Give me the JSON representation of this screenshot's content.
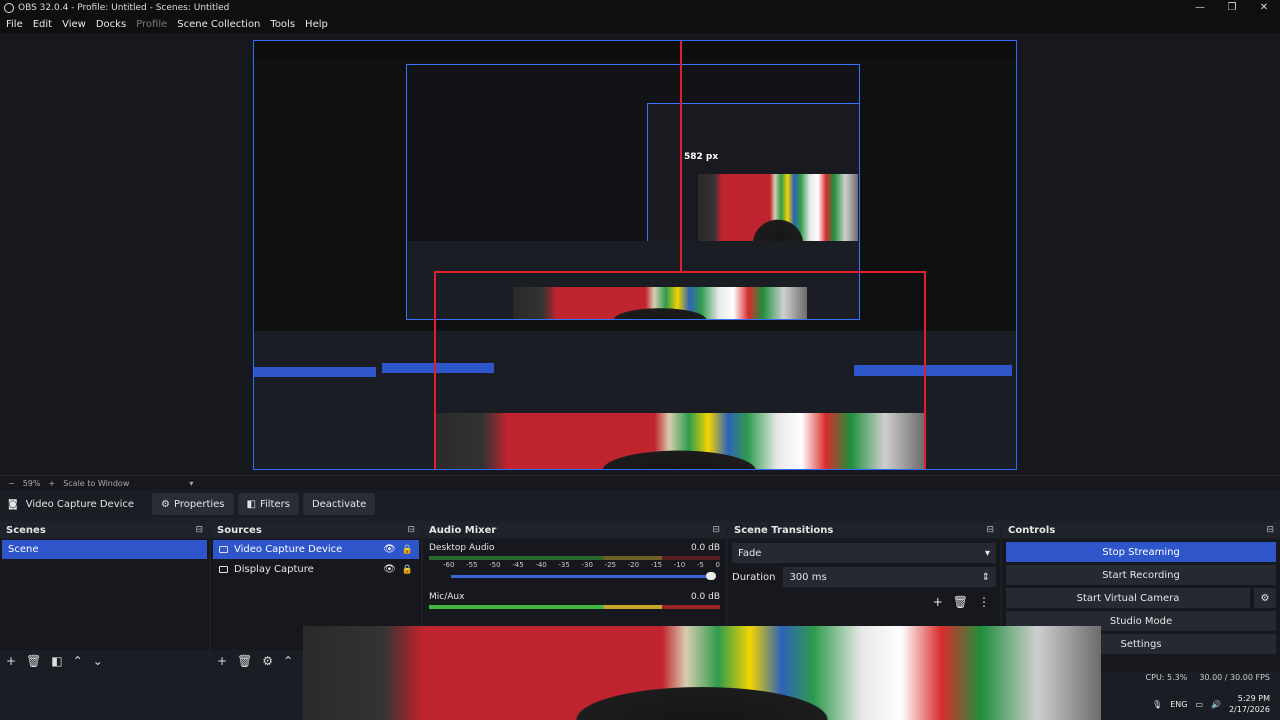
{
  "window": {
    "title": "OBS 32.0.4 - Profile: Untitled - Scenes: Untitled",
    "minimize": "—",
    "restore": "❐",
    "close": "✕"
  },
  "menu": {
    "file": "File",
    "edit": "Edit",
    "view": "View",
    "docks": "Docks",
    "profile": "Profile",
    "scene_collection": "Scene Collection",
    "tools": "Tools",
    "help": "Help"
  },
  "preview": {
    "measurement_label": "582 px"
  },
  "zoom": {
    "minus": "−",
    "value": "59%",
    "plus": "+",
    "mode": "Scale to Window",
    "dropdown": "▾"
  },
  "source_bar": {
    "source_name": "Video Capture Device",
    "properties": "Properties",
    "filters": "Filters",
    "deactivate": "Deactivate"
  },
  "scenes": {
    "title": "Scenes",
    "items": [
      "Scene"
    ]
  },
  "sources": {
    "title": "Sources",
    "items": [
      "Video Capture Device",
      "Display Capture"
    ]
  },
  "audio_mixer": {
    "title": "Audio Mixer",
    "tracks": [
      {
        "name": "Desktop Audio",
        "level": "0.0 dB"
      },
      {
        "name": "Mic/Aux",
        "level": "0.0 dB"
      }
    ],
    "ticks": [
      "-60",
      "-55",
      "-50",
      "-45",
      "-40",
      "-35",
      "-30",
      "-25",
      "-20",
      "-15",
      "-10",
      "-5",
      "0"
    ]
  },
  "scene_transitions": {
    "title": "Scene Transitions",
    "transition": "Fade",
    "duration_label": "Duration",
    "duration_value": "300 ms"
  },
  "controls": {
    "title": "Controls",
    "stop_streaming": "Stop Streaming",
    "start_recording": "Start Recording",
    "start_virtual_camera": "Start Virtual Camera",
    "studio_mode": "Studio Mode",
    "settings": "Settings"
  },
  "status": {
    "cpu": "CPU: 5.3%",
    "fps": "30.00 / 30.00 FPS",
    "lang": "ENG",
    "time": "5:29 PM",
    "date": "2/17/2026"
  }
}
